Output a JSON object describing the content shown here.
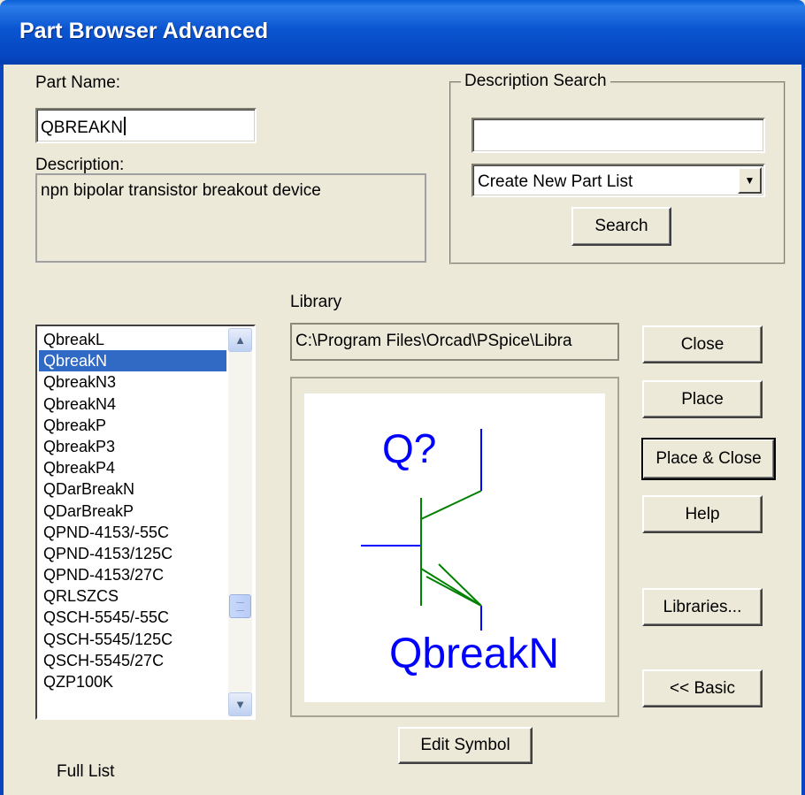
{
  "window": {
    "title": "Part Browser Advanced"
  },
  "part_name": {
    "label": "Part Name:",
    "value": "QBREAKN"
  },
  "description": {
    "label": "Description:",
    "value": "npn bipolar transistor breakout device"
  },
  "description_search": {
    "group_label": "Description Search",
    "input_value": "",
    "mode_selected": "Create New Part List",
    "search_button": "Search"
  },
  "library": {
    "label": "Library",
    "path": "C:\\Program Files\\Orcad\\PSpice\\Libra"
  },
  "part_list": {
    "items": [
      "QbreakL",
      "QbreakN",
      "QbreakN3",
      "QbreakN4",
      "QbreakP",
      "QbreakP3",
      "QbreakP4",
      "QDarBreakN",
      "QDarBreakP",
      "QPND-4153/-55C",
      "QPND-4153/125C",
      "QPND-4153/27C",
      "QRLSZCS",
      "QSCH-5545/-55C",
      "QSCH-5545/125C",
      "QSCH-5545/27C",
      "QZP100K"
    ],
    "selected": "QbreakN",
    "footer_label": "Full List"
  },
  "preview": {
    "refdes": "Q?",
    "part_value": "QbreakN",
    "text_color": "#0000ff",
    "pin_color": "#0000ff",
    "body_color": "#008000"
  },
  "buttons": {
    "close": "Close",
    "place": "Place",
    "place_close": "Place & Close",
    "help": "Help",
    "libraries": "Libraries...",
    "basic": "<< Basic",
    "edit_symbol": "Edit Symbol"
  },
  "icons": {
    "dropdown": "chevron-down-icon",
    "scroll_up": "scroll-up-icon",
    "scroll_down": "scroll-down-icon"
  }
}
